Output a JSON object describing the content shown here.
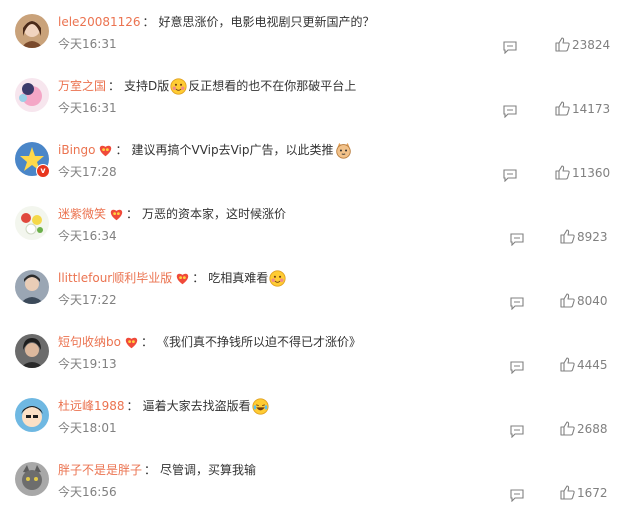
{
  "comments": [
    {
      "user": "lele20081126",
      "badge": false,
      "text": "好意思涨价，电影电视剧只更新国产的？",
      "emoji": [],
      "time": "今天16:31",
      "likes": "23824",
      "avatar": "portrait-woman"
    },
    {
      "user": "万室之国",
      "badge": false,
      "text": "支持D版",
      "emoji": [
        "smile-blush"
      ],
      "text2": "反正想看的也不在你那破平台上",
      "time": "今天16:31",
      "likes": "14173",
      "avatar": "cartoon-pink"
    },
    {
      "user": "iBingo",
      "badge": true,
      "text": "建议再搞个VVip去Vip广告，以此类推",
      "emoji": [
        "cat-face"
      ],
      "time": "今天17:28",
      "likes": "11360",
      "avatar": "star-blue",
      "verified": true
    },
    {
      "user": "迷紫微笑",
      "badge": true,
      "text": "万恶的资本家，这时候涨价",
      "emoji": [],
      "time": "今天16:34",
      "likes": "8923",
      "avatar": "flowers"
    },
    {
      "user": "llittlefour顺利毕业版",
      "badge": true,
      "text": "吃相真难看",
      "emoji": [
        "smile-blush"
      ],
      "time": "今天17:22",
      "likes": "8040",
      "avatar": "person-dark"
    },
    {
      "user": "短句收纳bo",
      "badge": true,
      "text": "《我们真不挣钱所以迫不得已才涨价》",
      "emoji": [],
      "time": "今天19:13",
      "likes": "4445",
      "avatar": "person-hair"
    },
    {
      "user": "杜远峰1988",
      "badge": false,
      "text": "逼着大家去找盗版看",
      "emoji": [
        "laugh-cry"
      ],
      "time": "今天18:01",
      "likes": "2688",
      "avatar": "cartoon-boy"
    },
    {
      "user": "胖子不是是胖子",
      "badge": false,
      "text": "尽管调，买算我输",
      "emoji": [],
      "time": "今天16:56",
      "likes": "1672",
      "avatar": "cat-grey"
    }
  ],
  "colors": {
    "username": "#eb7350",
    "text": "#333333",
    "meta": "#808080"
  }
}
